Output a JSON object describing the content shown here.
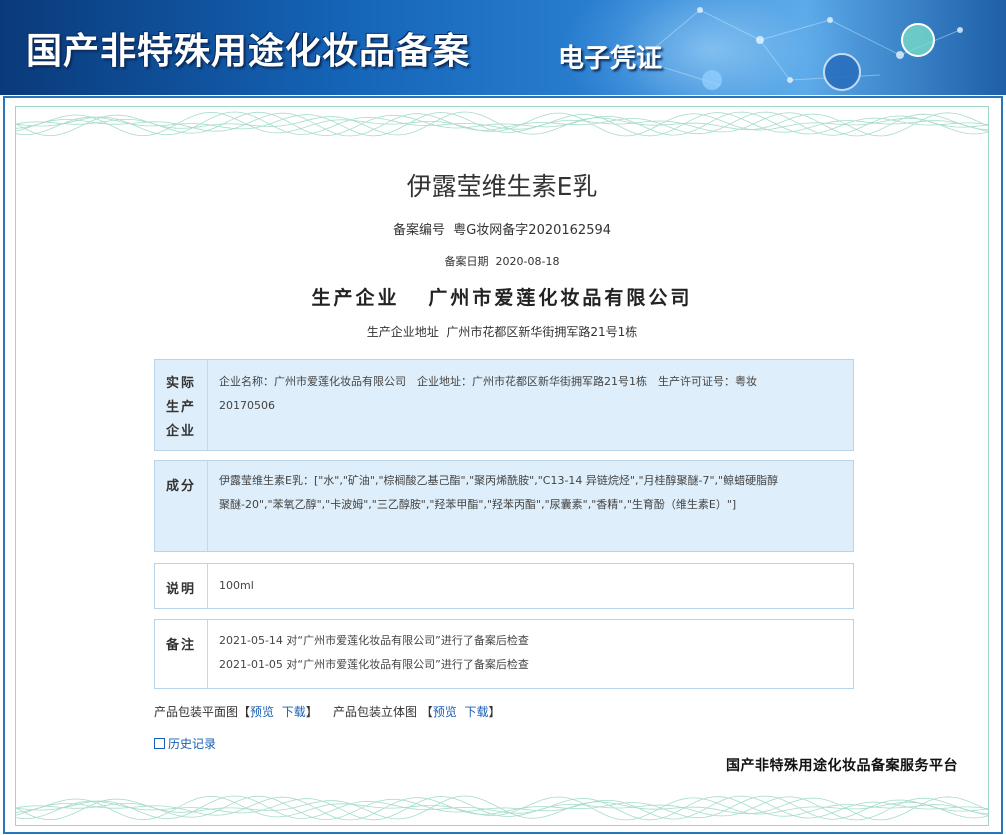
{
  "header": {
    "title": "国产非特殊用途化妆品备案",
    "subtitle": "电子凭证"
  },
  "product": {
    "name": "伊露莹维生素E乳",
    "reg_no_label": "备案编号",
    "reg_no": "粤G妆网备字2020162594",
    "reg_date_label": "备案日期",
    "reg_date": "2020-08-18",
    "company_label": "生产企业",
    "company": "广州市爱莲化妆品有限公司",
    "address_label": "生产企业地址",
    "address": "广州市花都区新华街拥军路21号1栋"
  },
  "sections": {
    "actual": {
      "label_1": "实际",
      "label_2": "生产",
      "label_3": "企业",
      "line_1": "企业名称：广州市爱莲化妆品有限公司　企业地址：广州市花都区新华街拥军路21号1栋　生产许可证号：粤妆",
      "line_2": "20170506"
    },
    "ingredients": {
      "label": "成分",
      "line_1": "伊露莹维生素E乳：[\"水\",\"矿油\",\"棕榈酸乙基己酯\",\"聚丙烯酰胺\",\"C13-14 异链烷烃\",\"月桂醇聚醚-7\",\"鲸蜡硬脂醇",
      "line_2": "聚醚-20\",\"苯氧乙醇\",\"卡波姆\",\"三乙醇胺\",\"羟苯甲酯\",\"羟苯丙酯\",\"尿囊素\",\"香精\",\"生育酚（维生素E）\"]"
    },
    "note": {
      "label": "说明",
      "value": "100ml"
    },
    "remark": {
      "label": "备注",
      "line_1": "2021-05-14 对“广州市爱莲化妆品有限公司”进行了备案后检查",
      "line_2": "2021-01-05 对“广州市爱莲化妆品有限公司”进行了备案后检查"
    }
  },
  "packaging": {
    "flat_label": "产品包装平面图",
    "solid_label": "产品包装立体图",
    "preview": "预览",
    "download": "下载"
  },
  "history_link": "历史记录",
  "platform": "国产非特殊用途化妆品备案服务平台",
  "colors": {
    "header_dark": "#0a3a7a",
    "header_light": "#5aa8e8",
    "frame": "#2a74b8",
    "section_bg": "#deeefa",
    "link": "#1a5fb4",
    "guilloche": "#9fd6c9"
  },
  "icons": {
    "history": "external-window-icon"
  }
}
